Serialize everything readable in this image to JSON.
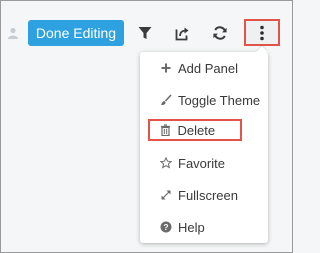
{
  "toolbar": {
    "done_label": "Done Editing",
    "icons": [
      "user-icon",
      "filter-icon",
      "share-icon",
      "refresh-icon",
      "more-vertical-icon"
    ]
  },
  "menu": {
    "items": [
      {
        "label": "Add Panel",
        "icon": "plus-icon"
      },
      {
        "label": "Toggle Theme",
        "icon": "brush-icon"
      },
      {
        "label": "Delete",
        "icon": "trash-icon"
      },
      {
        "label": "Favorite",
        "icon": "star-icon"
      },
      {
        "label": "Fullscreen",
        "icon": "expand-icon"
      },
      {
        "label": "Help",
        "icon": "help-icon"
      }
    ]
  },
  "colors": {
    "accent": "#2ea1e0",
    "highlight_border": "#e4534a",
    "background": "#f5f6f7"
  }
}
